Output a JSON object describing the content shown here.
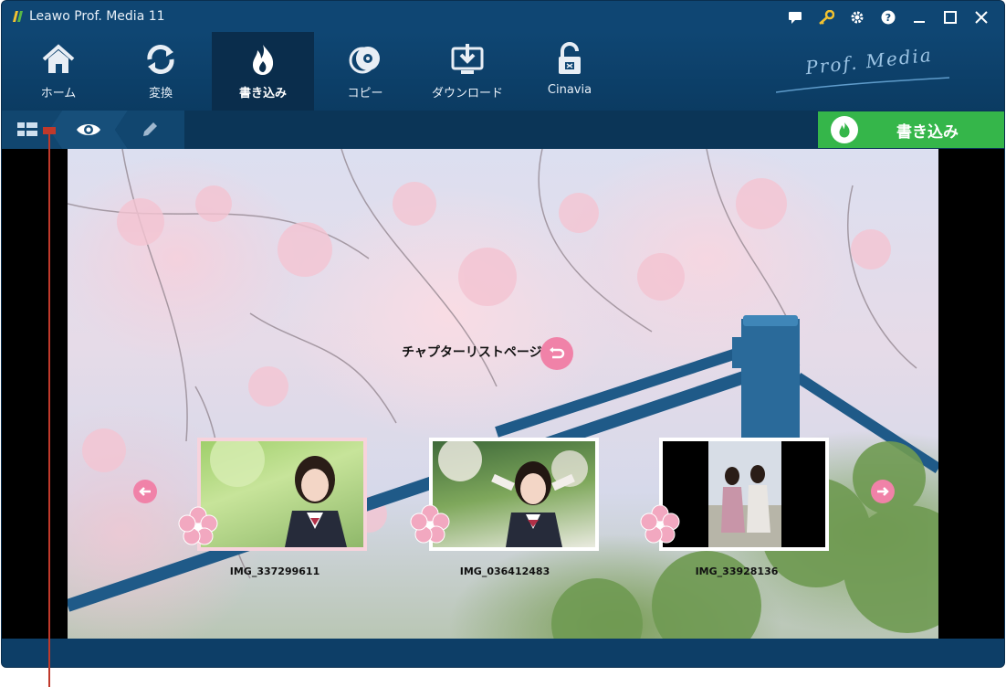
{
  "window": {
    "title": "Leawo Prof. Media 11"
  },
  "titlebar_icons": [
    "feedback-icon",
    "key-icon",
    "gear-icon",
    "help-icon",
    "minimize-icon",
    "maximize-icon",
    "close-icon"
  ],
  "nav": {
    "items": [
      {
        "label": "ホーム",
        "icon": "home-icon",
        "active": false
      },
      {
        "label": "変換",
        "icon": "convert-icon",
        "active": false
      },
      {
        "label": "書き込み",
        "icon": "burn-icon",
        "active": true
      },
      {
        "label": "コピー",
        "icon": "copy-disc-icon",
        "active": false
      },
      {
        "label": "ダウンロード",
        "icon": "download-icon",
        "active": false
      },
      {
        "label": "Cinavia",
        "icon": "cinavia-lock-icon",
        "active": false
      }
    ],
    "brand": "Prof. Media"
  },
  "toolbar": {
    "burn_button_label": "書き込み",
    "accent_color": "#35b64a"
  },
  "menu_preview": {
    "title": "チャプターリストページ",
    "chapters": [
      {
        "label": "IMG_337299611"
      },
      {
        "label": "IMG_036412483"
      },
      {
        "label": "IMG_33928136"
      }
    ],
    "button_color": "#f082a8"
  }
}
